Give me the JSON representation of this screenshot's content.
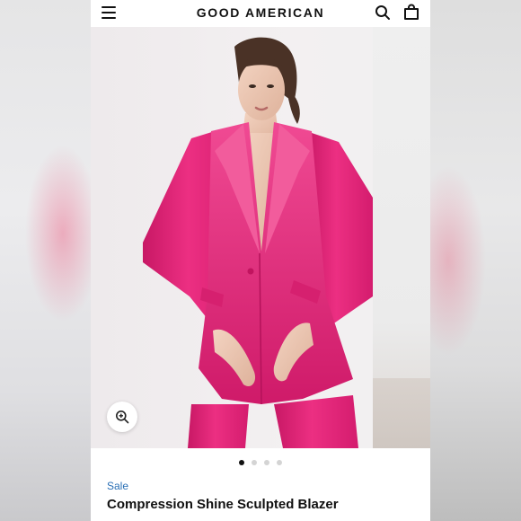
{
  "header": {
    "brand": "GOOD AMERICAN",
    "menu_icon": "hamburger-menu-icon",
    "search_icon": "search-icon",
    "bag_icon": "shopping-bag-icon"
  },
  "gallery": {
    "zoom_icon": "zoom-in-icon",
    "slide_count": 4,
    "active_slide": 1
  },
  "product": {
    "badge": "Sale",
    "title": "Compression Shine Sculpted Blazer"
  },
  "colors": {
    "garment_pink": "#e8287a",
    "sale_blue": "#2a6fb5",
    "text_dark": "#111111"
  }
}
